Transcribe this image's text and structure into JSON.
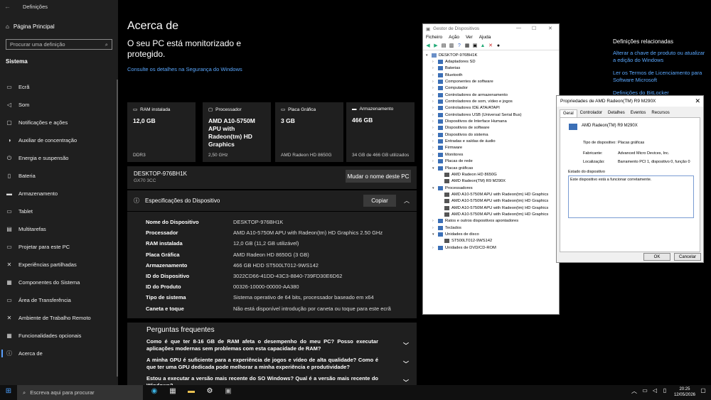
{
  "settings": {
    "window_title": "Definições",
    "home": "Página Principal",
    "search_placeholder": "Procurar uma definição",
    "section": "Sistema",
    "nav": [
      {
        "icon": "▭",
        "label": "Ecrã"
      },
      {
        "icon": "◁",
        "label": "Som"
      },
      {
        "icon": "▢",
        "label": "Notificações e ações"
      },
      {
        "icon": "◑",
        "label": "Auxiliar de concentração"
      },
      {
        "icon": "⏻",
        "label": "Energia e suspensão"
      },
      {
        "icon": "▯",
        "label": "Bateria"
      },
      {
        "icon": "▬",
        "label": "Armazenamento"
      },
      {
        "icon": "▭",
        "label": "Tablet"
      },
      {
        "icon": "▤",
        "label": "Multitarefas"
      },
      {
        "icon": "▭",
        "label": "Projetar para este PC"
      },
      {
        "icon": "✕",
        "label": "Experiências partilhadas"
      },
      {
        "icon": "▦",
        "label": "Componentes do Sistema"
      },
      {
        "icon": "▭",
        "label": "Área de Transferência"
      },
      {
        "icon": "✕",
        "label": "Ambiente de Trabalho Remoto"
      },
      {
        "icon": "▦",
        "label": "Funcionalidades opcionais"
      },
      {
        "icon": "ⓘ",
        "label": "Acerca de"
      }
    ]
  },
  "main": {
    "title": "Acerca de",
    "protection": "O seu PC está monitorizado e protegido.",
    "link": "Consulte os detalhes na Segurança do Windows",
    "cards": [
      {
        "label": "RAM instalada",
        "value": "12,0 GB",
        "sub": "DDR3"
      },
      {
        "label": "Processador",
        "value": "AMD A10-5750M APU with Radeon(tm) HD Graphics",
        "sub": "2,50 GHz"
      },
      {
        "label": "Placa Gráfica",
        "value": "3 GB",
        "sub": "AMD Radeon HD 8650G"
      },
      {
        "label": "Armazenamento",
        "value": "466 GB",
        "sub": "34 GB de 466 GB utilizados"
      }
    ],
    "pc_name": "DESKTOP-976BH1K",
    "pc_model": "GX70 3CC",
    "rename_button": "Mudar o nome deste PC",
    "spec_title": "Especificações do Dispositivo",
    "copy_button": "Copiar",
    "specs": [
      {
        "k": "Nome do Dispositivo",
        "v": "DESKTOP-976BH1K"
      },
      {
        "k": "Processador",
        "v": "AMD A10-5750M APU with Radeon(tm) HD Graphics      2.50 GHz"
      },
      {
        "k": "RAM instalada",
        "v": "12,0 GB (11,2 GB utilizável)"
      },
      {
        "k": "Placa Gráfica",
        "v": "AMD Radeon HD 8650G (3 GB)"
      },
      {
        "k": "Armazenamento",
        "v": "466 GB HDD ST500LT012-9WS142"
      },
      {
        "k": "ID do Dispositivo",
        "v": "3022CD66-41DD-43C3-8840-739FD30E6D62"
      },
      {
        "k": "ID do Produto",
        "v": "00326-10000-00000-AA380"
      },
      {
        "k": "Tipo de sistema",
        "v": "Sistema operativo de 64 bits, processador baseado em x64"
      },
      {
        "k": "Caneta e toque",
        "v": "Não está disponível introdução por caneta ou toque para este ecrã"
      }
    ],
    "faq_title": "Perguntas frequentes",
    "faq": [
      "Como é que ter 8-16 GB de RAM afeta o desempenho do meu PC? Posso executar aplicações modernas sem problemas com esta capacidade de RAM?",
      "A minha GPU é suficiente para a experiência de jogos e vídeo de alta qualidade? Como é que ter uma GPU dedicada pode melhorar a minha experiência e produtividade?",
      "Estou a executar a versão mais recente do SO Windows? Qual é a versão mais recente do Windows?"
    ]
  },
  "devmgr": {
    "title": "Gestor de Dispositivos",
    "menu": [
      "Ficheiro",
      "Ação",
      "Ver",
      "Ajuda"
    ],
    "tree": [
      {
        "d": 0,
        "ar": "▾",
        "t": "DESKTOP-976BH1K"
      },
      {
        "d": 1,
        "ar": "›",
        "t": "Adaptadores SD"
      },
      {
        "d": 1,
        "ar": "›",
        "t": "Baterias"
      },
      {
        "d": 1,
        "ar": "›",
        "t": "Bluetooth"
      },
      {
        "d": 1,
        "ar": "›",
        "t": "Componentes de software"
      },
      {
        "d": 1,
        "ar": "›",
        "t": "Computador"
      },
      {
        "d": 1,
        "ar": "›",
        "t": "Controladores de armazenamento"
      },
      {
        "d": 1,
        "ar": "›",
        "t": "Controladores de som, vídeo e jogos"
      },
      {
        "d": 1,
        "ar": "›",
        "t": "Controladores IDE ATA/ATAPI"
      },
      {
        "d": 1,
        "ar": "›",
        "t": "Controladores USB (Universal Serial Bus)"
      },
      {
        "d": 1,
        "ar": "›",
        "t": "Dispositivos de Interface Humana"
      },
      {
        "d": 1,
        "ar": "›",
        "t": "Dispositivos de software"
      },
      {
        "d": 1,
        "ar": "›",
        "t": "Dispositivos do sistema"
      },
      {
        "d": 1,
        "ar": "›",
        "t": "Entradas e saídas de áudio"
      },
      {
        "d": 1,
        "ar": "›",
        "t": "Firmware"
      },
      {
        "d": 1,
        "ar": "›",
        "t": "Monitores"
      },
      {
        "d": 1,
        "ar": "›",
        "t": "Placas de rede"
      },
      {
        "d": 1,
        "ar": "▾",
        "t": "Placas gráficas"
      },
      {
        "d": 2,
        "ar": "",
        "t": "AMD Radeon HD 8650G"
      },
      {
        "d": 2,
        "ar": "",
        "t": "AMD Radeon(TM) R9 M290X"
      },
      {
        "d": 1,
        "ar": "▾",
        "t": "Processadores"
      },
      {
        "d": 2,
        "ar": "",
        "t": "AMD A10-5750M APU with Radeon(tm) HD Graphics"
      },
      {
        "d": 2,
        "ar": "",
        "t": "AMD A10-5750M APU with Radeon(tm) HD Graphics"
      },
      {
        "d": 2,
        "ar": "",
        "t": "AMD A10-5750M APU with Radeon(tm) HD Graphics"
      },
      {
        "d": 2,
        "ar": "",
        "t": "AMD A10-5750M APU with Radeon(tm) HD Graphics"
      },
      {
        "d": 1,
        "ar": "›",
        "t": "Ratos e outros dispositivos apontadores"
      },
      {
        "d": 1,
        "ar": "›",
        "t": "Teclados"
      },
      {
        "d": 1,
        "ar": "▾",
        "t": "Unidades de disco"
      },
      {
        "d": 2,
        "ar": "",
        "t": "ST500LT012-9WS142"
      },
      {
        "d": 1,
        "ar": "›",
        "t": "Unidades de DVD/CD-ROM"
      }
    ]
  },
  "props": {
    "title": "Propriedades de AMD Radeon(TM) R9 M290X",
    "tabs": [
      "Geral",
      "Controlador",
      "Detalhes",
      "Eventos",
      "Recursos"
    ],
    "device": "AMD Radeon(TM) R9 M290X",
    "type_k": "Tipo de dispositivo:",
    "type_v": "Placas gráficas",
    "maker_k": "Fabricante:",
    "maker_v": "Advanced Micro Devices, Inc.",
    "loc_k": "Localização:",
    "loc_v": "Barramento PCI 1, dispositivo 0, função 0",
    "status_label": "Estado do dispositivo",
    "status": "Este dispositivo está a funcionar corretamente.",
    "ok": "OK",
    "cancel": "Cancelar"
  },
  "related": {
    "title": "Definições relacionadas",
    "links": [
      "Alterar a chave de produto ou atualizar a edição do Windows",
      "Ler os Termos de Licenciamento para Software Microsoft",
      "Definições do BitLocker"
    ]
  },
  "taskbar": {
    "search": "Escreva aqui para procurar",
    "time": "20:25",
    "date": "12/05/2026"
  }
}
